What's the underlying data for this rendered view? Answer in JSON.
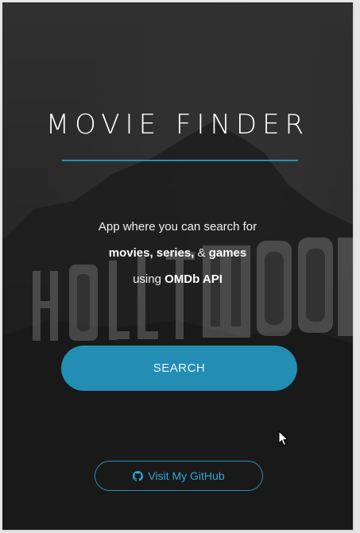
{
  "app": {
    "title": "MOVIE FINDER",
    "description": {
      "line1": "App where you can search for",
      "line2_bold_a": "movies, series,",
      "line2_plain": " & ",
      "line2_bold_b": "games",
      "line3_plain": "using ",
      "line3_bold": "OMDb API"
    },
    "search_label": "SEARCH",
    "github_label": "Visit My GitHub"
  },
  "icons": {
    "github": "github-icon",
    "cursor": "mouse-cursor-icon"
  },
  "colors": {
    "accent": "#238db3",
    "accent_text": "#2fa6d4",
    "title_rule": "#2b8fb5"
  }
}
